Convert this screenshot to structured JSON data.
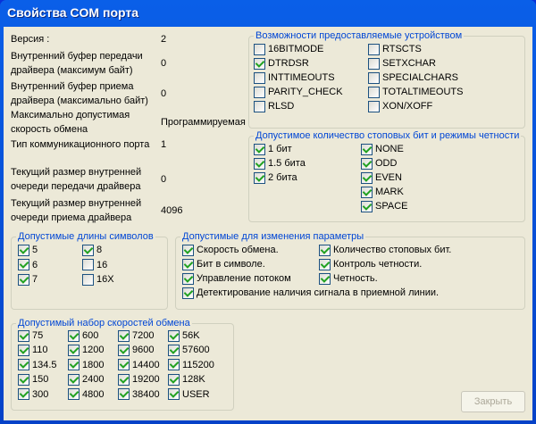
{
  "window": {
    "title": "Свойства COM порта"
  },
  "info": [
    {
      "label": "Версия :",
      "value": "2"
    },
    {
      "label": "Внутренний буфер передачи драйвера (максимум байт)",
      "value": "0"
    },
    {
      "label": "Внутренний буфер приема драйвера (максимально байт)",
      "value": "0"
    },
    {
      "label": "Максимально допустимая скорость обмена",
      "value": "Программируемая"
    },
    {
      "label": "Тип коммуникационного порта",
      "value": "1"
    },
    {
      "label": "Текущий размер внутренней очереди передачи драйвера",
      "value": "0"
    },
    {
      "label": "Текущий размер внутренней очереди приема драйвера",
      "value": "4096"
    }
  ],
  "groups": [
    {
      "title": "Возможности предоставляемые устройством",
      "items": [
        {
          "label": "16BITMODE",
          "checked": false
        },
        {
          "label": "DTRDSR",
          "checked": true
        },
        {
          "label": "INTTIMEOUTS",
          "checked": false
        },
        {
          "label": "PARITY_CHECK",
          "checked": false
        },
        {
          "label": "RLSD",
          "checked": false
        },
        {
          "label": "RTSCTS",
          "checked": false
        },
        {
          "label": "SETXCHAR",
          "checked": false
        },
        {
          "label": "SPECIALCHARS",
          "checked": false
        },
        {
          "label": "TOTALTIMEOUTS",
          "checked": false
        },
        {
          "label": "XON/XOFF",
          "checked": false
        }
      ]
    },
    {
      "title": "Допустимое количество стоповых бит и режимы четности",
      "items": [
        {
          "label": "1 бит",
          "checked": true
        },
        {
          "label": "1.5 бита",
          "checked": true
        },
        {
          "label": "2 бита",
          "checked": true
        },
        {
          "label": "NONE",
          "checked": true
        },
        {
          "label": "ODD",
          "checked": true
        },
        {
          "label": "EVEN",
          "checked": true
        },
        {
          "label": "MARK",
          "checked": true
        },
        {
          "label": "SPACE",
          "checked": true
        }
      ]
    },
    {
      "title": "Допустимые длины символов",
      "items": [
        {
          "label": "5",
          "checked": true
        },
        {
          "label": "6",
          "checked": true
        },
        {
          "label": "7",
          "checked": true
        },
        {
          "label": "8",
          "checked": true
        },
        {
          "label": "16",
          "checked": false
        },
        {
          "label": "16X",
          "checked": false
        }
      ]
    },
    {
      "title": "Допустимые для изменения параметры",
      "items": [
        {
          "label": "Скорость обмена.",
          "checked": true
        },
        {
          "label": "Бит в символе.",
          "checked": true
        },
        {
          "label": "Управление потоком",
          "checked": true
        },
        {
          "label": "Количество стоповых бит.",
          "checked": true
        },
        {
          "label": "Контроль четности.",
          "checked": true
        },
        {
          "label": "Четность.",
          "checked": true
        },
        {
          "label": "Детектирование наличия сигнала в приемной линии.",
          "checked": true
        }
      ]
    },
    {
      "title": "Допустимый набор скоростей обмена",
      "items": [
        {
          "label": "75",
          "checked": true
        },
        {
          "label": "110",
          "checked": true
        },
        {
          "label": "134.5",
          "checked": true
        },
        {
          "label": "150",
          "checked": true
        },
        {
          "label": "300",
          "checked": true
        },
        {
          "label": "600",
          "checked": true
        },
        {
          "label": "1200",
          "checked": true
        },
        {
          "label": "1800",
          "checked": true
        },
        {
          "label": "2400",
          "checked": true
        },
        {
          "label": "4800",
          "checked": true
        },
        {
          "label": "7200",
          "checked": true
        },
        {
          "label": "9600",
          "checked": true
        },
        {
          "label": "14400",
          "checked": true
        },
        {
          "label": "19200",
          "checked": true
        },
        {
          "label": "38400",
          "checked": true
        },
        {
          "label": "56K",
          "checked": true
        },
        {
          "label": "57600",
          "checked": true
        },
        {
          "label": "115200",
          "checked": true
        },
        {
          "label": "128K",
          "checked": true
        },
        {
          "label": "USER",
          "checked": true
        }
      ]
    }
  ],
  "close_label": "Закрыть"
}
